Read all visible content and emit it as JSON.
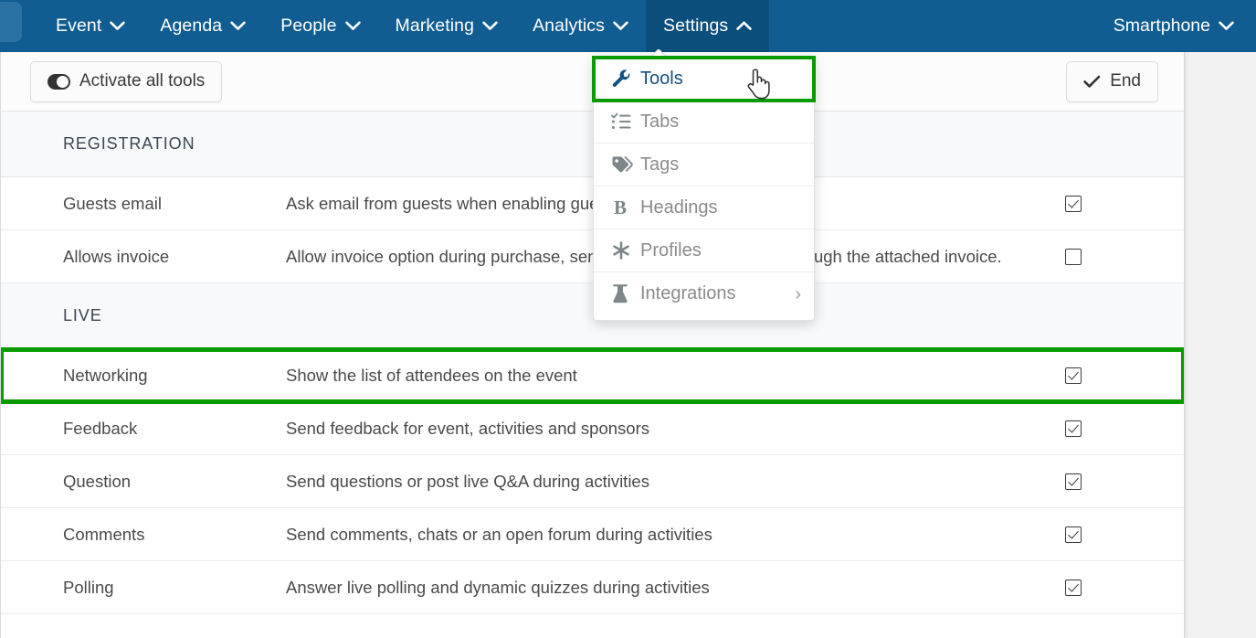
{
  "colors": {
    "nav_blue": "#115d92",
    "nav_active_blue": "#0c4e7c",
    "highlight_green": "#0a9b00",
    "selected_menu_text": "#16507f",
    "page_bg": "#f2f2f2"
  },
  "navbar": {
    "items": [
      {
        "label": "Event",
        "icon": "chevron-down-icon",
        "active": false
      },
      {
        "label": "Agenda",
        "icon": "chevron-down-icon",
        "active": false
      },
      {
        "label": "People",
        "icon": "chevron-down-icon",
        "active": false
      },
      {
        "label": "Marketing",
        "icon": "chevron-down-icon",
        "active": false
      },
      {
        "label": "Analytics",
        "icon": "chevron-down-icon",
        "active": false
      },
      {
        "label": "Settings",
        "icon": "chevron-up-icon",
        "active": true
      }
    ],
    "right": {
      "label": "Smartphone",
      "icon": "chevron-down-icon"
    }
  },
  "dropdown": {
    "items": [
      {
        "label": "Tools",
        "icon": "wrench-icon",
        "selected": true,
        "submenu": false
      },
      {
        "label": "Tabs",
        "icon": "list-checks-icon",
        "selected": false,
        "submenu": false
      },
      {
        "label": "Tags",
        "icon": "tag-icon",
        "selected": false,
        "submenu": false
      },
      {
        "label": "Headings",
        "icon": "bold-b-icon",
        "selected": false,
        "submenu": false
      },
      {
        "label": "Profiles",
        "icon": "asterisk-icon",
        "selected": false,
        "submenu": false
      },
      {
        "label": "Integrations",
        "icon": "flask-icon",
        "selected": false,
        "submenu": true,
        "chevron": "›"
      }
    ]
  },
  "toolbar": {
    "activate_all_label": "Activate all tools",
    "end_label": "End"
  },
  "sections": [
    {
      "title": "REGISTRATION",
      "rows": [
        {
          "name": "Guests email",
          "description": "Ask email from guests when enabling guest registration on the form.",
          "checked": true
        },
        {
          "name": "Allows invoice",
          "description": "Allow invoice option during purchase, sending the payment details through the attached invoice.",
          "checked": false
        }
      ]
    },
    {
      "title": "LIVE",
      "rows": [
        {
          "name": "Networking",
          "description": "Show the list of attendees on the event",
          "checked": true,
          "highlighted": true
        },
        {
          "name": "Feedback",
          "description": "Send feedback for event, activities and sponsors",
          "checked": true
        },
        {
          "name": "Question",
          "description": "Send questions or post live Q&A during activities",
          "checked": true
        },
        {
          "name": "Comments",
          "description": "Send comments, chats or an open forum during activities",
          "checked": true
        },
        {
          "name": "Polling",
          "description": "Answer live polling and dynamic quizzes during activities",
          "checked": true
        }
      ]
    }
  ]
}
